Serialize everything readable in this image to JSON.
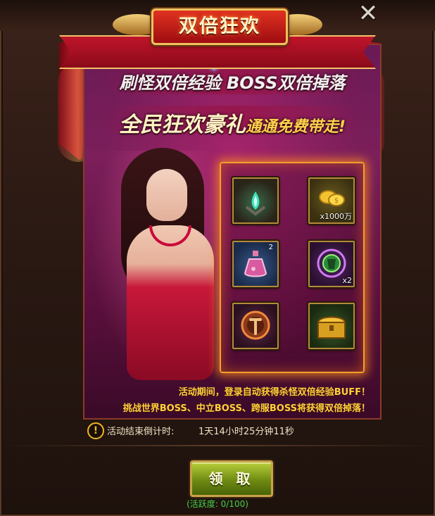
{
  "window": {
    "title": "双倍狂欢",
    "close_icon": "close-x-icon"
  },
  "promo": {
    "line1": "刷怪双倍经验  BOSS双倍掉落",
    "line2_main": "全民狂欢豪礼",
    "line2_sub": "通通免费带走!",
    "accent_color": "#ffd24a"
  },
  "rewards": [
    {
      "icon": "spirit-flame-icon",
      "count": "",
      "sup": ""
    },
    {
      "icon": "gold-coins-icon",
      "count": "x1000万",
      "sup": ""
    },
    {
      "icon": "pink-potion-icon",
      "count": "",
      "sup": "2"
    },
    {
      "icon": "green-armor-emblem-icon",
      "count": "x2",
      "sup": ""
    },
    {
      "icon": "sword-medallion-icon",
      "count": "",
      "sup": ""
    },
    {
      "icon": "golden-treasure-chest-icon",
      "count": "",
      "sup": ""
    }
  ],
  "description": {
    "line1": "活动期间，登录自动获得杀怪双倍经验BUFF！",
    "line2": "挑战世界BOSS、中立BOSS、跨服BOSS将获得双倍掉落！"
  },
  "countdown": {
    "icon": "exclamation-icon",
    "label": "活动结束倒计时:",
    "value": "1天14小时25分钟11秒"
  },
  "claim": {
    "label": "领 取",
    "activity_text": "(活跃度: 0/100)"
  }
}
